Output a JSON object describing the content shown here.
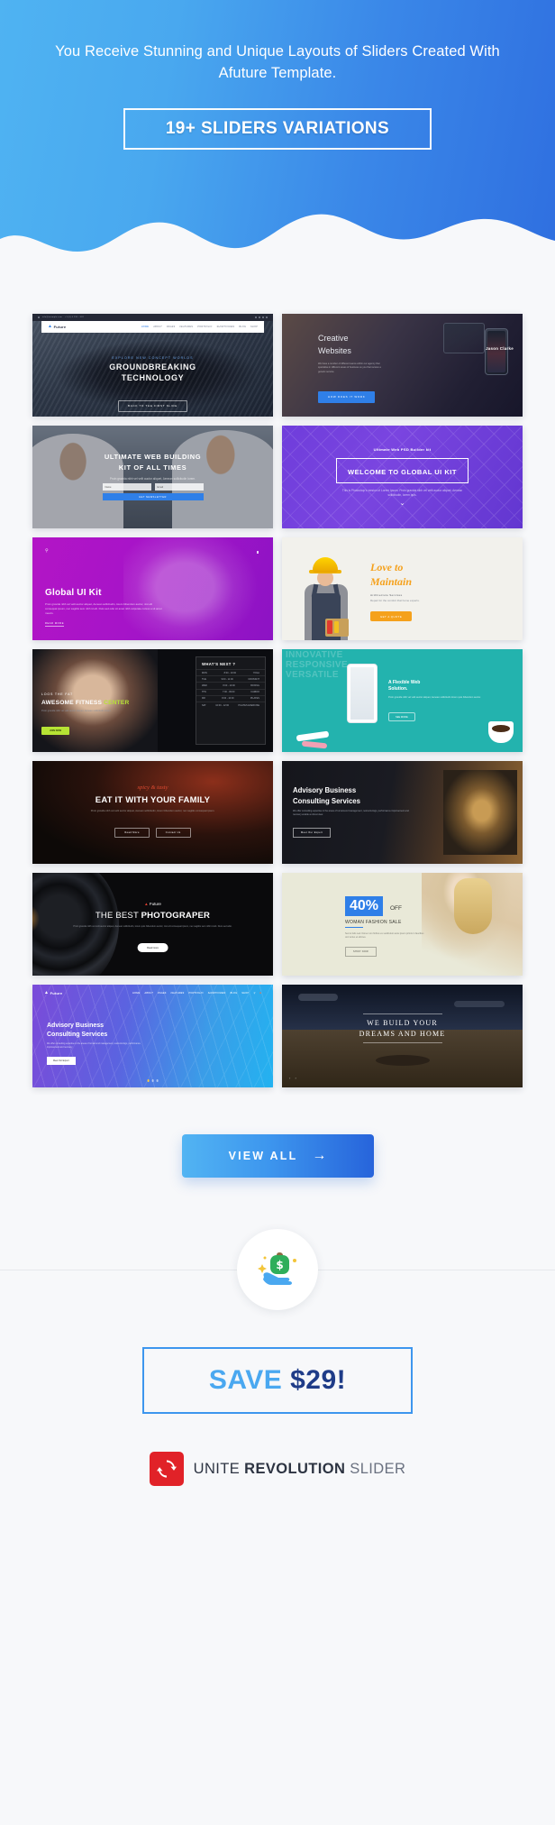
{
  "header": {
    "title": "You Receive Stunning and Unique Layouts of Sliders Created With Afuture Template.",
    "badge_label": "19+ SLIDERS VARIATIONS",
    "gradient_from": "#4fb3f2",
    "gradient_to": "#2f6fe0",
    "wave_color": "#f7f8fa"
  },
  "sliders": [
    {
      "id": "groundbreaking-technology",
      "brand": "Future",
      "topbar_email": "info@example.com",
      "topbar_phone": "+1 (0) 6 235 - 532",
      "nav": [
        "HOME",
        "ABOUT",
        "PAGES",
        "FEATURES",
        "PORTFOLIO",
        "SHORTCODES",
        "BLOG",
        "SHOP"
      ],
      "eyebrow": "Explore New Concept Worlds",
      "title_line1": "GROUNDBREAKING",
      "title_line2": "TECHNOLOGY",
      "button": "BACK TO THE FIRST SLIDE"
    },
    {
      "id": "creative-websites",
      "title_line1": "Creative",
      "title_line2": "Websites",
      "paragraph": "We have a number of different teams within our agency that specialise in different areas of business so you that receive a generic service.",
      "button": "HOW DOES IT WORK",
      "person_name": "Jason  Clarke"
    },
    {
      "id": "ultimate-web-building-kit",
      "title_line1": "ULTIMATE WEB BUILDING",
      "title_line2": "KIT OF ALL TIMES",
      "paragraph": "Proin gravida nibh vel velit auctor aliquet, Aenean sollicitudin lorem.",
      "field_name": "Name",
      "field_email": "Email",
      "button": "GET NEWSLETTER"
    },
    {
      "id": "welcome-to-global-ui-kit",
      "eyebrow": "Ultimate Web PSD Builder kit",
      "title": "WELCOME TO GLOBAL UI KIT",
      "paragraph": "This is Photoshop's version of Lorem Ipsum. Proin gravida nibh vel velit auctor aliquet, Aenean sollicitudin, lorem quis.",
      "scroll_icon": "chevron-down-icon"
    },
    {
      "id": "global-ui-kit",
      "title": "Global UI Kit",
      "paragraph": "Proin gravida nibh vel velit auctor aliquet, Aenean sollicitudin, lorem bibendum auctor, nisi elit consequat ipsum, nec sagittis sem nibh id elit. Duis sed odio sit amet nibh vulputate cursus a sit amet mauris.",
      "button": "READ MORE"
    },
    {
      "id": "love-to-maintain",
      "title_line1": "Love to",
      "title_line2": "Maintain",
      "subtitle": "Architecture Services",
      "paragraph": "Repair for the comfort that home experts.",
      "button": "GET A QUOTE"
    },
    {
      "id": "awesome-fitness-center",
      "eyebrow": "LOOS THE FAT",
      "title_prefix": "AWESOME FITNESS ",
      "title_accent": "CENTER",
      "paragraph": "Proin gravida nibh vel velit auctor aliquet, Aenean sollicitudin lorem.",
      "button": "JOIN NOW",
      "panel_title": "WHAT'S NEXT ?",
      "panel_rows": [
        {
          "label": "MON",
          "value": "8:00 - 10:00",
          "tag": "YOGA"
        },
        {
          "label": "TUE",
          "value": "9:00 - 11:00",
          "tag": "CROSSFIT"
        },
        {
          "label": "WED",
          "value": "8:00 - 10:00",
          "tag": "BOXING"
        },
        {
          "label": "THU",
          "value": "7:00 - 09:00",
          "tag": "CARDIO"
        },
        {
          "label": "FRI",
          "value": "8:00 - 10:00",
          "tag": "PILATES"
        },
        {
          "label": "SAT",
          "value": "10:00 - 12:00",
          "tag": "PILATES EXERCISE"
        }
      ]
    },
    {
      "id": "flexible-web-solution",
      "ghost_line1": "INNOVATIVE",
      "ghost_line2": "RESPONSIVE",
      "ghost_line3": "VERSATILE",
      "title_line1": "A Flexible Web",
      "title_line2": "Solution.",
      "paragraph": "Proin gravida nibh vel velit auctor aliquet, Aenean sollicitudin lorem quis bibendum auctor.",
      "button": "SEE MORE"
    },
    {
      "id": "eat-it-with-your-family",
      "eyebrow": "spicy & tasty",
      "title": "EAT IT WITH YOUR FAMILY",
      "paragraph": "Proin gravida nibh vel velit auctor aliquet, Aenean sollicitudin, lorem bibendum auctor, nec sagittis consequat ipsum.",
      "button_primary": "Read More",
      "button_secondary": "Contact Us"
    },
    {
      "id": "advisory-business-consulting-gavel",
      "title_line1": "Advisory Business",
      "title_line2": "Consulting Services",
      "paragraph": "We offer consulting expertise in the areas of turnaround management, restructurings, performance improvement and recovery enable a robust view.",
      "button": "Meet Our Expert"
    },
    {
      "id": "the-best-photograper",
      "brand": "Future",
      "title_prefix": "THE BEST ",
      "title_bold": "PHOTOGRAPER",
      "paragraph": "Proin gravida nibh vel velit auctor aliquet, Aenean sollicitudin, lorem quis bibendum auctor, nisi elit consequat ipsum, nec sagittis sem nibh id elit. Duis sed odio.",
      "button": "Read more"
    },
    {
      "id": "woman-fashion-sale",
      "discount": "40%",
      "discount_suffix": "OFF",
      "subtitle": "WOMAN FASHION SALE",
      "paragraph": "Sed ut felis sed. Donec non finibus ex vestibulum ante ipsum primis in faucibus orci luctus et ultrices.",
      "button": "SHOP NOW"
    },
    {
      "id": "advisory-business-consulting-blue",
      "brand": "Future",
      "nav": [
        "HOME",
        "ABOUT",
        "PAGES",
        "FEATURES",
        "PORTFOLIO",
        "SHORTCODES",
        "BLOG",
        "SHOP"
      ],
      "title_line1": "Advisory Business",
      "title_line2": "Consulting Services",
      "paragraph": "We offer consulting expertise in the areas of turnaround management, restructurings, performance improvement and recovery.",
      "button": "Meet Our Expert"
    },
    {
      "id": "we-build-your-dreams-and-home",
      "title_line1": "WE BUILD YOUR",
      "title_line2": "DREAMS AND HOME",
      "nav_icon": "prev-next-arrows-icon"
    }
  ],
  "cta": {
    "view_all_label": "VIEW ALL",
    "view_all_arrow": "→",
    "money_icon": "money-in-hand-icon"
  },
  "save": {
    "light_part": "SAVE ",
    "dark_part": "$29!",
    "border_color": "#3d96ee"
  },
  "footer": {
    "logo_icon": "refresh-circle-icon",
    "word_1": "UNITE ",
    "word_2": "REVOLUTION",
    "word_3": " SLIDER",
    "brand_color": "#e12228"
  }
}
